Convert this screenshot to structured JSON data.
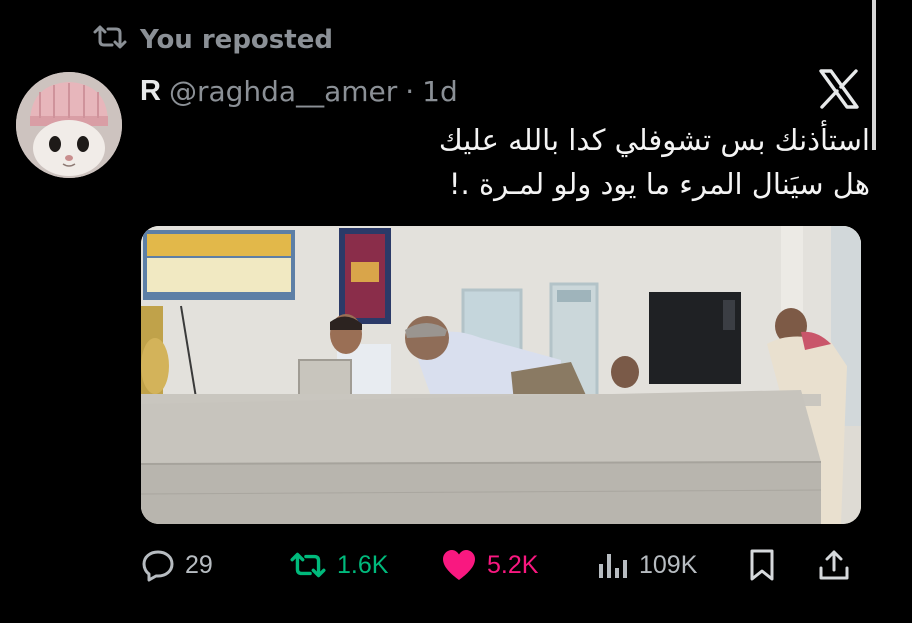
{
  "repost_banner": {
    "icon": "repost-icon",
    "label": "You reposted"
  },
  "author": {
    "initial": "R",
    "handle": "@raghda__amer",
    "separator": "·",
    "time": "1d",
    "avatar_icon": "cat-in-beanie-avatar"
  },
  "platform_logo": "x-logo-icon",
  "tweet": {
    "lines": [
      "استأذنك بس تشوفلي كدا بالله عليك",
      "هل سيَنال المرء ما يود ولو لمـرة .!"
    ]
  },
  "actions": {
    "reply": {
      "icon": "reply-icon",
      "count": "29"
    },
    "repost": {
      "icon": "repost-icon",
      "count": "1.6K",
      "color": "#00ba7c"
    },
    "like": {
      "icon": "heart-icon",
      "count": "5.2K",
      "color": "#f91880"
    },
    "views": {
      "icon": "views-icon",
      "count": "109K"
    },
    "bookmark": {
      "icon": "bookmark-icon"
    },
    "share": {
      "icon": "share-icon"
    }
  },
  "colors": {
    "background": "#000000",
    "muted_text": "#8b9096",
    "primary_text": "#e7e9ea"
  }
}
